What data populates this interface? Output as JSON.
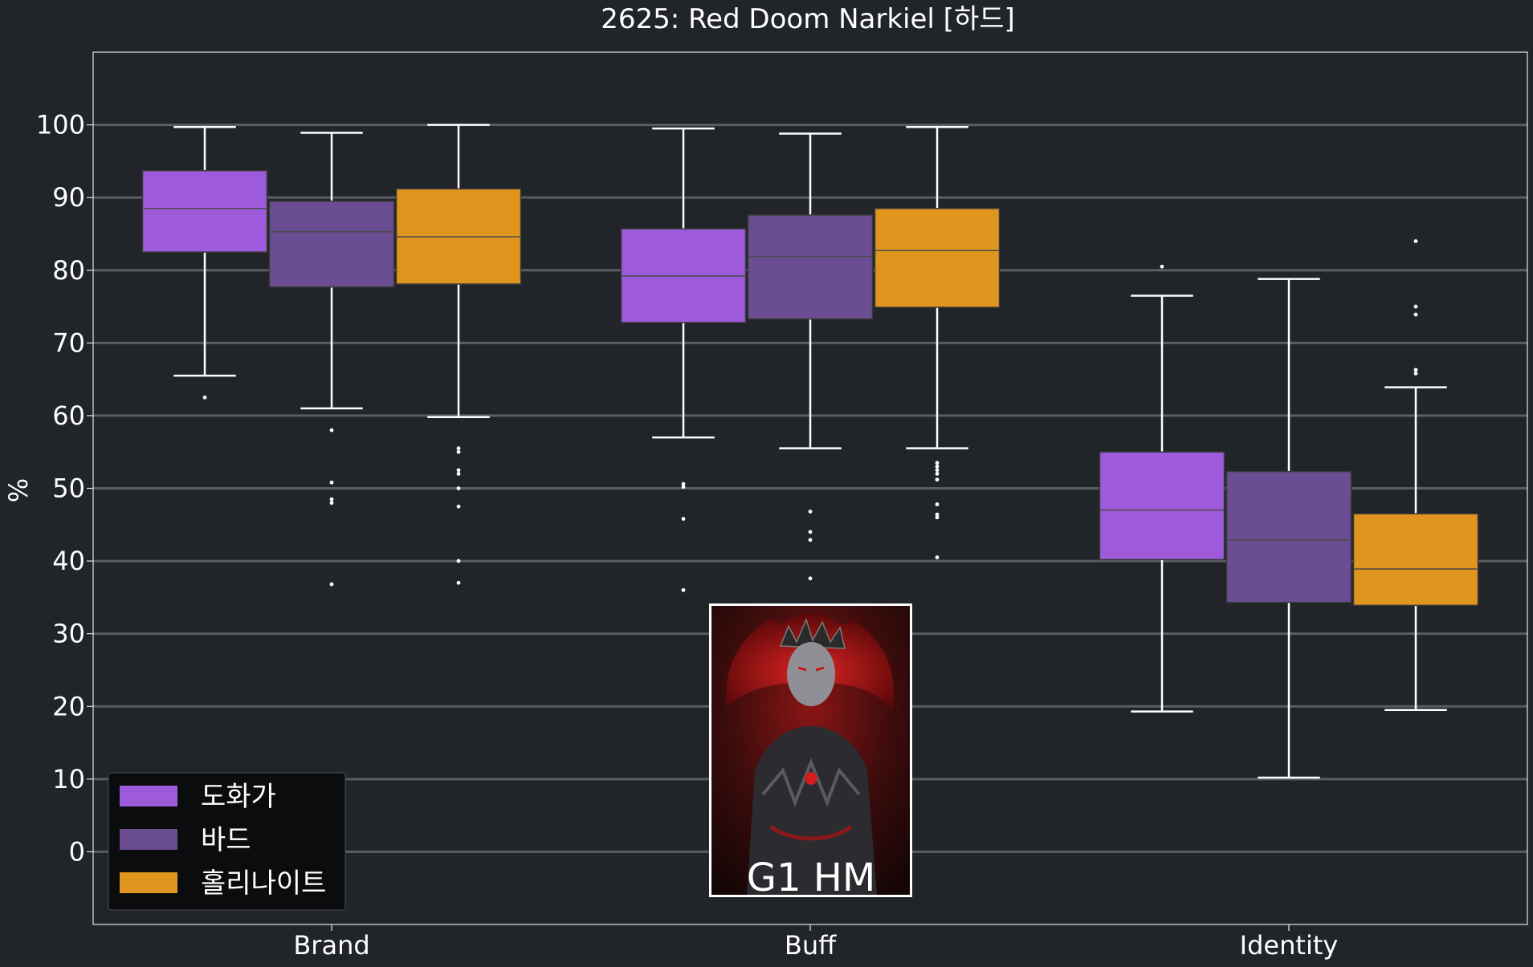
{
  "chart_data": {
    "type": "box",
    "title": "2625: Red Doom Narkiel [하드]",
    "xlabel": "",
    "ylabel": "%",
    "categories": [
      "Brand",
      "Buff",
      "Identity"
    ],
    "y_ticks": [
      0,
      10,
      20,
      30,
      40,
      50,
      60,
      70,
      80,
      90,
      100
    ],
    "ylim": [
      -10,
      110
    ],
    "grid": true,
    "legend_position": "bottom-left",
    "series": [
      {
        "name": "도화가",
        "color": "#9D5BDB",
        "boxes": [
          {
            "whisker_low": 65.5,
            "q1": 82.5,
            "median": 88.5,
            "q3": 93.7,
            "whisker_high": 99.7,
            "outliers": [
              62.5
            ]
          },
          {
            "whisker_low": 57.0,
            "q1": 72.8,
            "median": 79.2,
            "q3": 85.7,
            "whisker_high": 99.5,
            "outliers": [
              50.6,
              50.2,
              45.8,
              36.0
            ]
          },
          {
            "whisker_low": 19.3,
            "q1": 40.2,
            "median": 47.0,
            "q3": 55.0,
            "whisker_high": 76.5,
            "outliers": [
              80.5
            ]
          }
        ]
      },
      {
        "name": "바드",
        "color": "#6A4E91",
        "boxes": [
          {
            "whisker_low": 61.0,
            "q1": 77.7,
            "median": 85.3,
            "q3": 89.5,
            "whisker_high": 98.9,
            "outliers": [
              58.0,
              50.8,
              48.5,
              48.0,
              36.8
            ]
          },
          {
            "whisker_low": 55.5,
            "q1": 73.3,
            "median": 81.9,
            "q3": 87.6,
            "whisker_high": 98.8,
            "outliers": [
              46.8,
              44.0,
              42.9,
              37.6
            ]
          },
          {
            "whisker_low": 10.2,
            "q1": 34.3,
            "median": 42.9,
            "q3": 52.3,
            "whisker_high": 78.8,
            "outliers": []
          }
        ]
      },
      {
        "name": "홀리나이트",
        "color": "#E0951F",
        "boxes": [
          {
            "whisker_low": 59.8,
            "q1": 78.1,
            "median": 84.6,
            "q3": 91.2,
            "whisker_high": 100.0,
            "outliers": [
              55.5,
              55.0,
              52.5,
              52.0,
              50.0,
              47.5,
              40.0,
              37.0
            ]
          },
          {
            "whisker_low": 55.5,
            "q1": 74.9,
            "median": 82.7,
            "q3": 88.5,
            "whisker_high": 99.7,
            "outliers": [
              53.5,
              53.0,
              52.5,
              52.0,
              51.2,
              47.8,
              46.4,
              46.0,
              40.5
            ]
          },
          {
            "whisker_low": 19.5,
            "q1": 33.9,
            "median": 38.9,
            "q3": 46.5,
            "whisker_high": 63.9,
            "outliers": [
              84.0,
              75.0,
              73.9,
              66.3,
              65.8
            ]
          }
        ]
      }
    ]
  },
  "inset": {
    "caption": "G1 HM",
    "icon": "red-doom-narkiel-portrait"
  },
  "colors": {
    "background": "#212428",
    "grid": "#5A5D61",
    "text": "#ffffff",
    "legend_bg": "#0B0C0E"
  }
}
